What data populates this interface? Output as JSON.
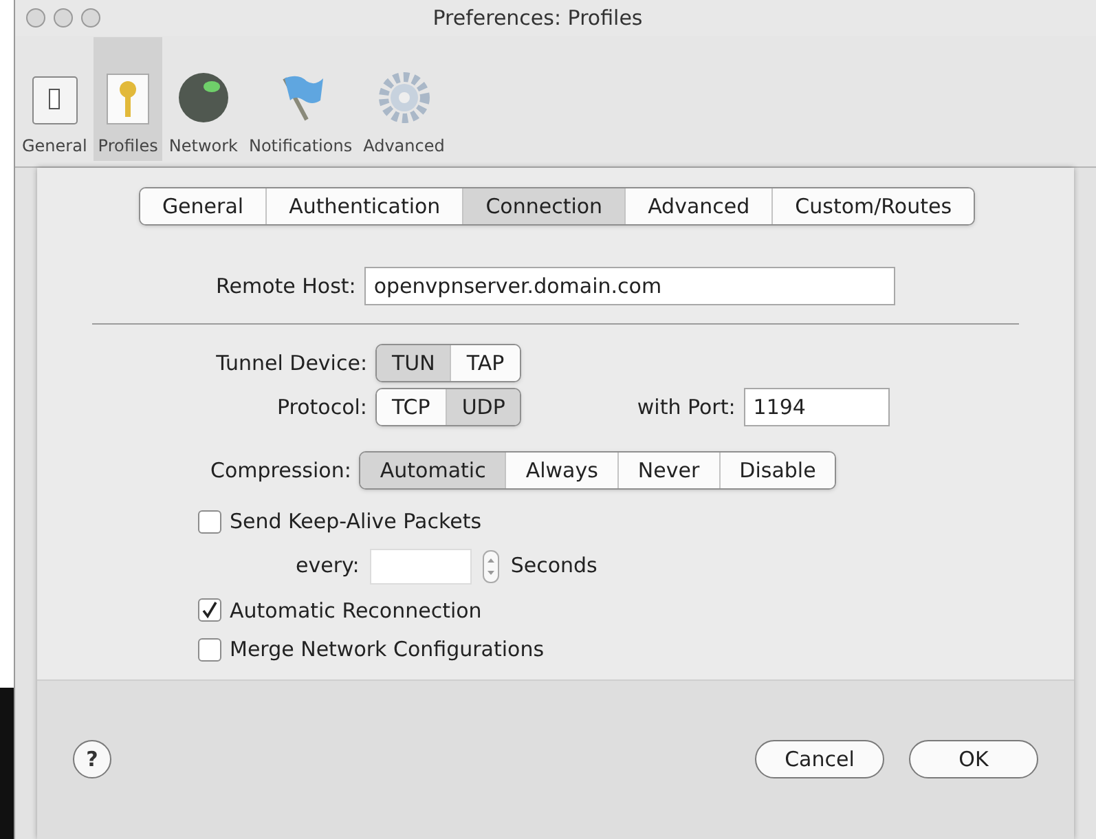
{
  "window": {
    "title": "Preferences: Profiles"
  },
  "toolbar": [
    {
      "label": "General",
      "kind": "switch",
      "selected": false
    },
    {
      "label": "Profiles",
      "kind": "key",
      "selected": true
    },
    {
      "label": "Network",
      "kind": "globe",
      "selected": false
    },
    {
      "label": "Notifications",
      "kind": "flag",
      "selected": false
    },
    {
      "label": "Advanced",
      "kind": "gear",
      "selected": false
    }
  ],
  "tabs": [
    {
      "label": "General",
      "selected": false
    },
    {
      "label": "Authentication",
      "selected": false
    },
    {
      "label": "Connection",
      "selected": true
    },
    {
      "label": "Advanced",
      "selected": false
    },
    {
      "label": "Custom/Routes",
      "selected": false
    }
  ],
  "remote_host": {
    "label": "Remote Host:",
    "value": "openvpnserver.domain.com"
  },
  "tunnel_device": {
    "label": "Tunnel Device:",
    "options": [
      {
        "label": "TUN",
        "selected": true
      },
      {
        "label": "TAP",
        "selected": false
      }
    ]
  },
  "protocol": {
    "label": "Protocol:",
    "options": [
      {
        "label": "TCP",
        "selected": false
      },
      {
        "label": "UDP",
        "selected": true
      }
    ]
  },
  "port": {
    "label": "with Port:",
    "value": "1194"
  },
  "compression": {
    "label": "Compression:",
    "options": [
      {
        "label": "Automatic",
        "selected": true
      },
      {
        "label": "Always",
        "selected": false
      },
      {
        "label": "Never",
        "selected": false
      },
      {
        "label": "Disable",
        "selected": false
      }
    ]
  },
  "keep_alive": {
    "label": "Send Keep-Alive Packets",
    "checked": false,
    "every_label": "every:",
    "unit": "Seconds"
  },
  "checkboxes": [
    {
      "label": "Automatic Reconnection",
      "checked": true
    },
    {
      "label": "Merge Network Configurations",
      "checked": false
    }
  ],
  "help": {
    "label": "?"
  },
  "buttons": [
    {
      "label": "Cancel"
    },
    {
      "label": "OK"
    }
  ]
}
